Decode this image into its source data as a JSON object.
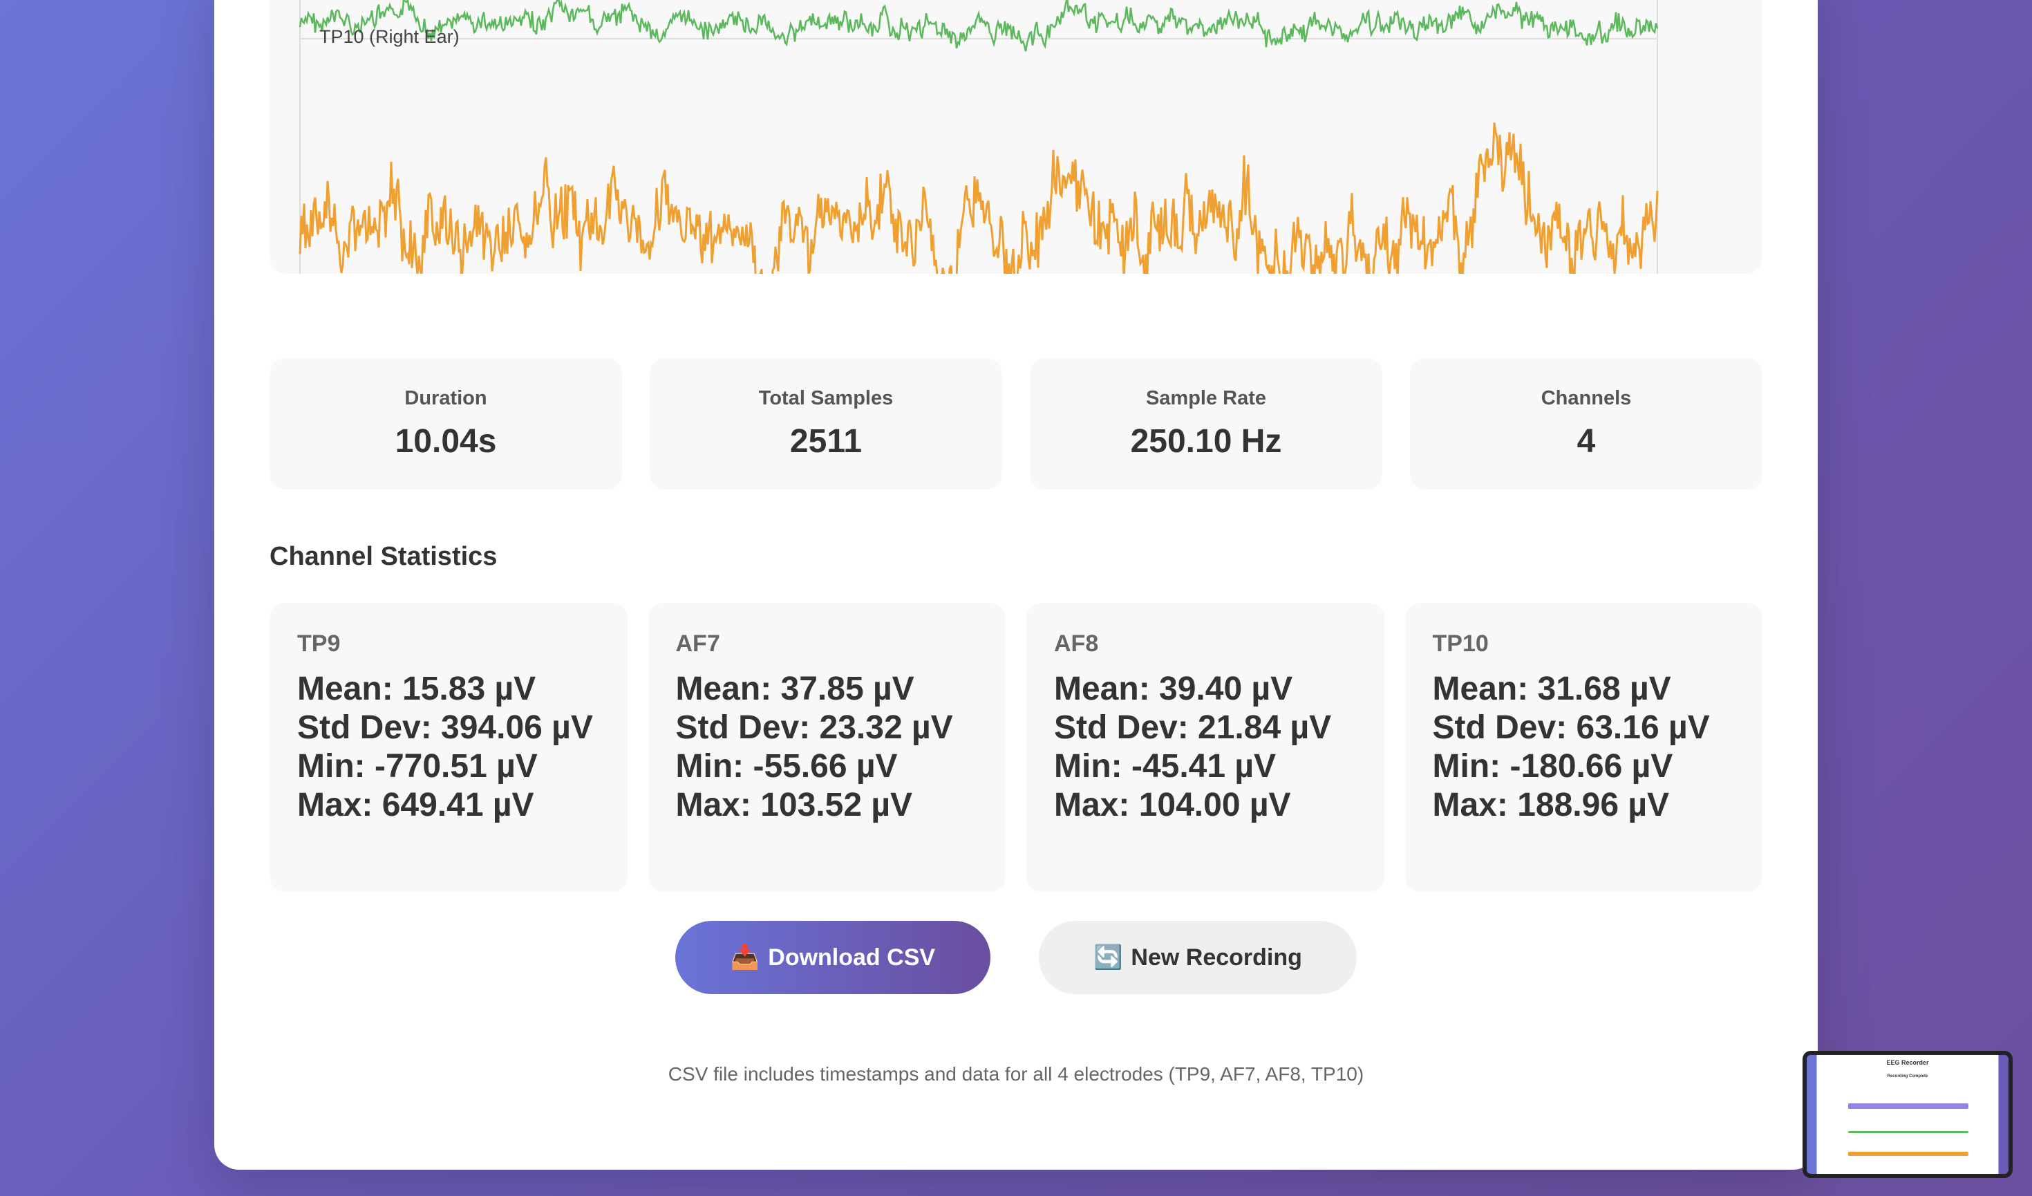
{
  "chart": {
    "channel_label": "TP10 (Right Ear)",
    "colors": {
      "green": "#5cb85c",
      "orange": "#f0a030"
    }
  },
  "summary": [
    {
      "label": "Duration",
      "value": "10.04s"
    },
    {
      "label": "Total Samples",
      "value": "2511"
    },
    {
      "label": "Sample Rate",
      "value": "250.10 Hz"
    },
    {
      "label": "Channels",
      "value": "4"
    }
  ],
  "channel_stats_title": "Channel Statistics",
  "channels": [
    {
      "name": "TP9",
      "mean": "Mean: 15.83 µV",
      "std": "Std Dev: 394.06 µV",
      "min": "Min: -770.51 µV",
      "max": "Max: 649.41 µV"
    },
    {
      "name": "AF7",
      "mean": "Mean: 37.85 µV",
      "std": "Std Dev: 23.32 µV",
      "min": "Min: -55.66 µV",
      "max": "Max: 103.52 µV"
    },
    {
      "name": "AF8",
      "mean": "Mean: 39.40 µV",
      "std": "Std Dev: 21.84 µV",
      "min": "Min: -45.41 µV",
      "max": "Max: 104.00 µV"
    },
    {
      "name": "TP10",
      "mean": "Mean: 31.68 µV",
      "std": "Std Dev: 63.16 µV",
      "min": "Min: -180.66 µV",
      "max": "Max: 188.96 µV"
    }
  ],
  "buttons": {
    "download_icon": "📥",
    "download_label": "Download CSV",
    "new_icon": "🔄",
    "new_label": "New Recording"
  },
  "footnote": "CSV file includes timestamps and data for all 4 electrodes (TP9, AF7, AF8, TP10)",
  "thumbnail": {
    "title": "EEG Recorder",
    "subtitle": "Recording Complete"
  }
}
